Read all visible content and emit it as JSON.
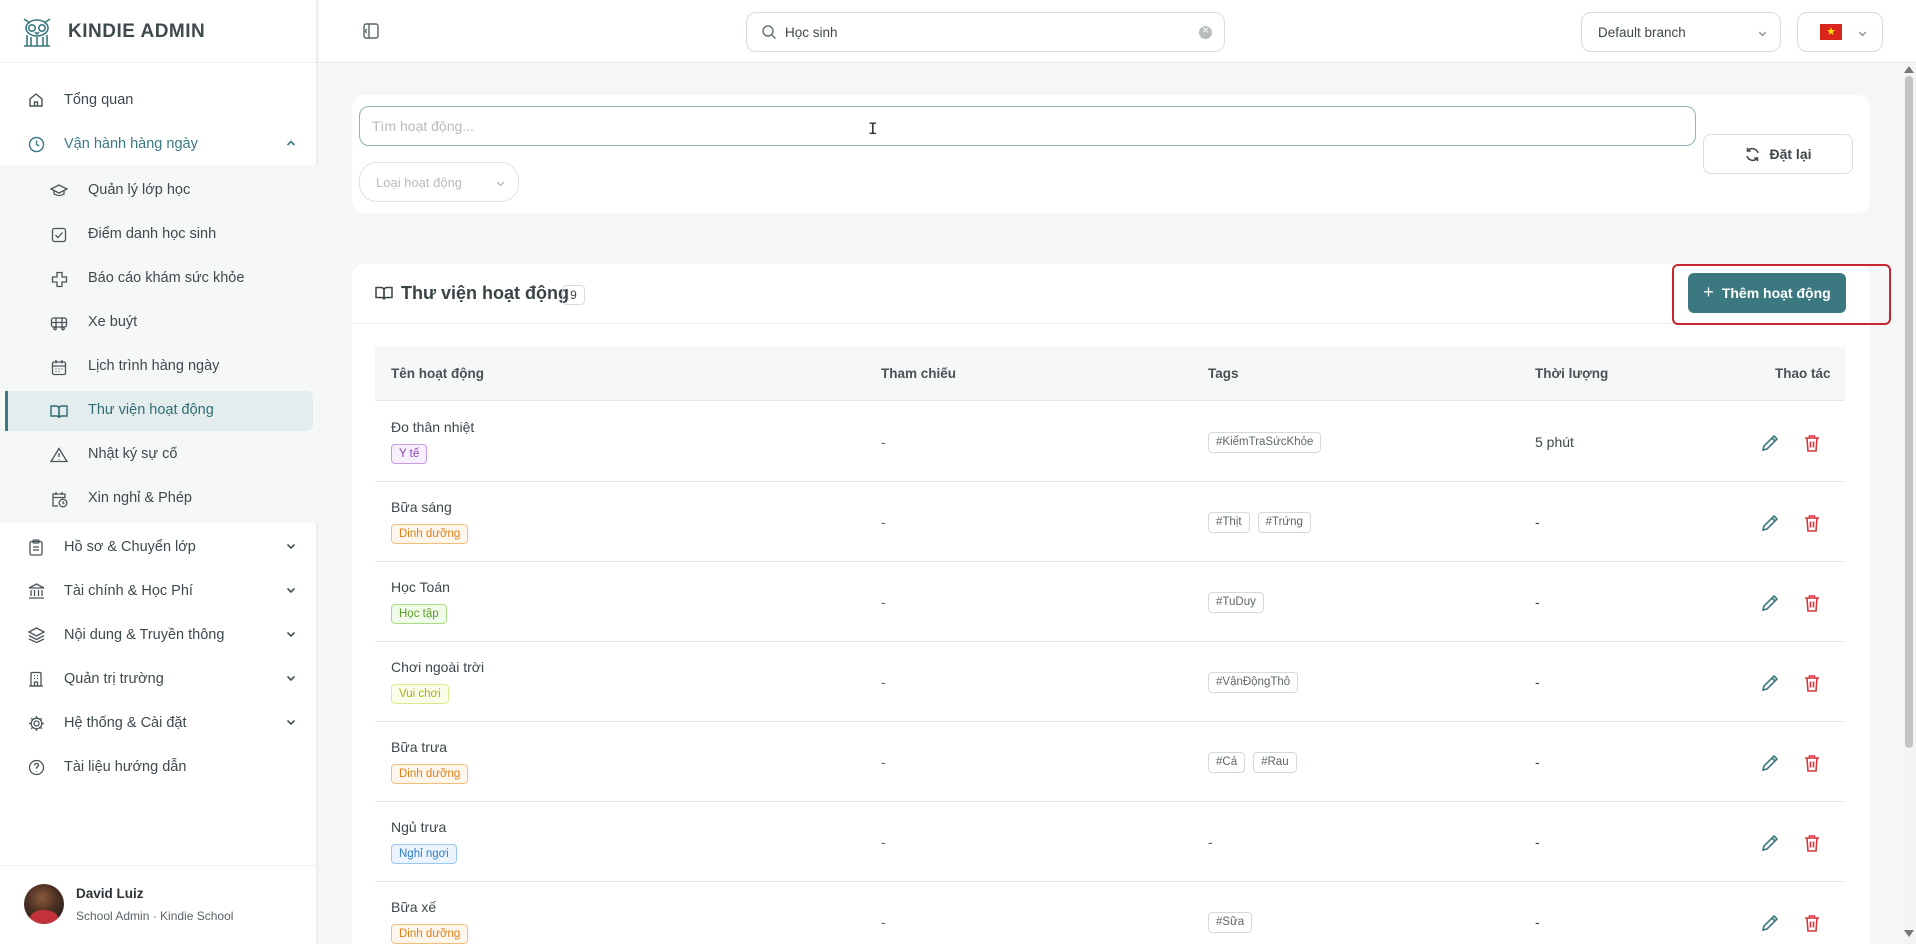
{
  "app": {
    "title": "KINDIE ADMIN",
    "logo_icon": "owl-logo-icon"
  },
  "header": {
    "search_value": "Học sinh",
    "branch": "Default branch",
    "language_flag": "vn-flag",
    "accent": "#3b787f"
  },
  "sidebar": {
    "items": [
      {
        "label": "Tổng quan",
        "icon": "home-icon"
      },
      {
        "label": "Vận hành hàng ngày",
        "icon": "clock-icon",
        "expanded": true
      },
      {
        "label": "Hồ sơ & Chuyển lớp",
        "icon": "clipboard-icon"
      },
      {
        "label": "Tài chính & Học Phí",
        "icon": "bank-icon"
      },
      {
        "label": "Nội dung & Truyền thông",
        "icon": "layers-icon"
      },
      {
        "label": "Quản trị trường",
        "icon": "building-icon"
      },
      {
        "label": "Hệ thống & Cài đặt",
        "icon": "gear-icon"
      },
      {
        "label": "Tài liệu hướng dẫn",
        "icon": "help-icon"
      }
    ],
    "sub_items": [
      {
        "label": "Quản lý lớp học",
        "icon": "graduation-cap-icon"
      },
      {
        "label": "Điểm danh học sinh",
        "icon": "check-square-icon"
      },
      {
        "label": "Báo cáo khám sức khỏe",
        "icon": "medical-cross-icon"
      },
      {
        "label": "Xe buýt",
        "icon": "bus-icon"
      },
      {
        "label": "Lịch trình hàng ngày",
        "icon": "calendar-icon"
      },
      {
        "label": "Thư viện hoạt động",
        "icon": "book-icon",
        "active": true
      },
      {
        "label": "Nhật ký sự cố",
        "icon": "warning-icon"
      },
      {
        "label": "Xin nghỉ & Phép",
        "icon": "calendar-clock-icon"
      }
    ],
    "user": {
      "name": "David Luiz",
      "role": "School Admin · Kindie School"
    }
  },
  "filters": {
    "search_placeholder": "Tìm hoạt động...",
    "type_placeholder": "Loại hoạt động",
    "reset_label": "Đặt lại"
  },
  "library": {
    "title": "Thư viện hoạt động",
    "count": "9",
    "add_label": "Thêm hoạt động",
    "columns": [
      "Tên hoạt động",
      "Tham chiếu",
      "Tags",
      "Thời lượng",
      "Thao tác"
    ],
    "rows": [
      {
        "name": "Đo thân nhiệt",
        "category": "Y tế",
        "cat_style": "medical",
        "reference": "-",
        "tags": [
          "#KiểmTraSứcKhỏe"
        ],
        "duration": "5 phút"
      },
      {
        "name": "Bữa sáng",
        "category": "Dinh dưỡng",
        "cat_style": "nutrition",
        "reference": "-",
        "tags": [
          "#Thịt",
          "#Trứng"
        ],
        "duration": "-"
      },
      {
        "name": "Học Toán",
        "category": "Học tập",
        "cat_style": "study",
        "reference": "-",
        "tags": [
          "#TuDuy"
        ],
        "duration": "-"
      },
      {
        "name": "Chơi ngoài trời",
        "category": "Vui chơi",
        "cat_style": "play",
        "reference": "-",
        "tags": [
          "#VậnĐộngThô"
        ],
        "duration": "-"
      },
      {
        "name": "Bữa trưa",
        "category": "Dinh dưỡng",
        "cat_style": "nutrition",
        "reference": "-",
        "tags": [
          "#Cá",
          "#Rau"
        ],
        "duration": "-"
      },
      {
        "name": "Ngủ trưa",
        "category": "Nghỉ ngơi",
        "cat_style": "rest",
        "reference": "-",
        "tags": [],
        "tags_empty": "-",
        "duration": "-"
      },
      {
        "name": "Bữa xế",
        "category": "Dinh dưỡng",
        "cat_style": "nutrition",
        "reference": "-",
        "tags": [
          "#Sữa"
        ],
        "duration": "-"
      }
    ]
  }
}
